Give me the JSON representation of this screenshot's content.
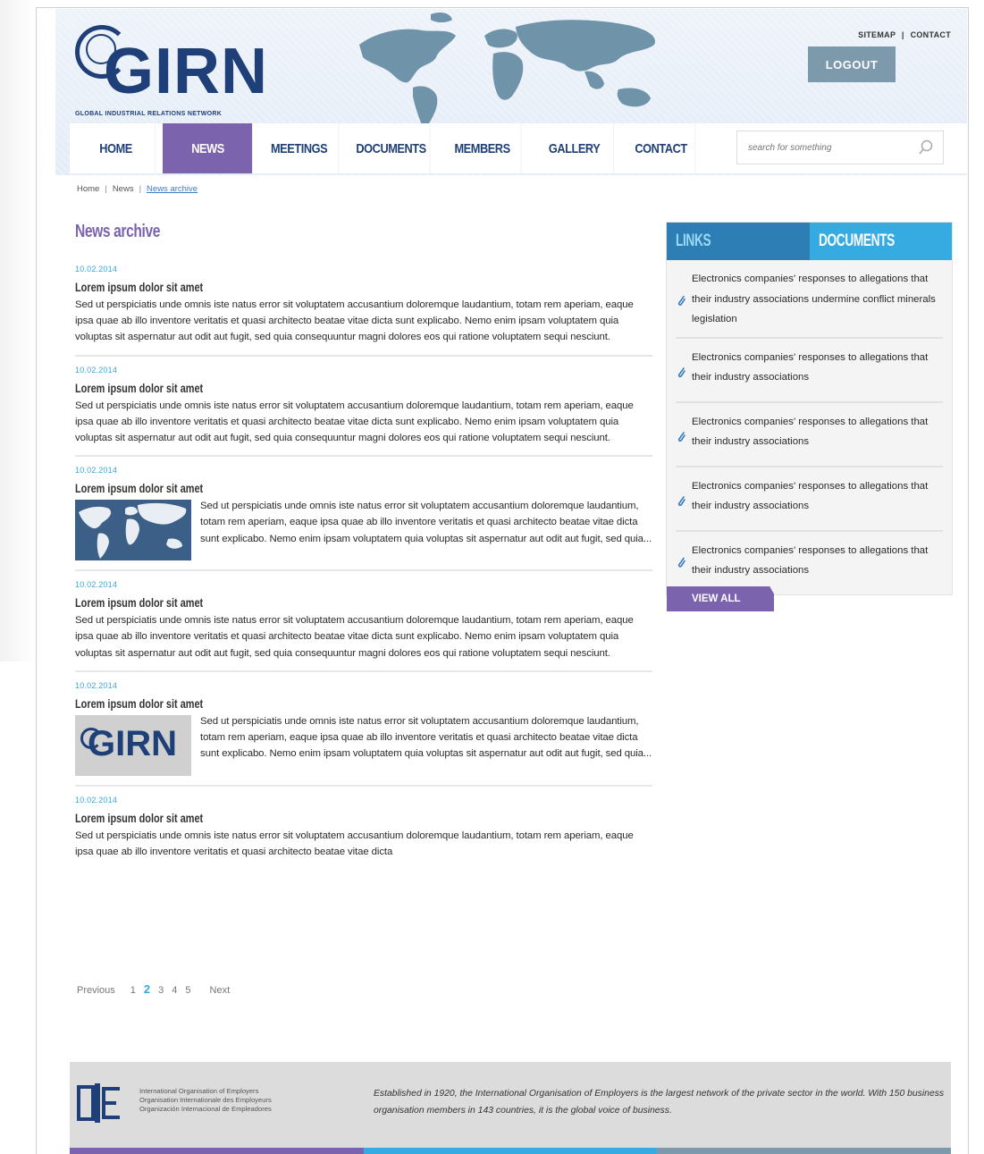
{
  "site": {
    "logo_text": "GIRN",
    "logo_tagline": "GLOBAL INDUSTRIAL RELATIONS NETWORK"
  },
  "toplinks": {
    "sitemap": "SITEMAP",
    "separator": "|",
    "contact": "CONTACT"
  },
  "logout_label": "LOGOUT",
  "nav": [
    {
      "label": "HOME",
      "active": false
    },
    {
      "label": "NEWS",
      "active": true
    },
    {
      "label": "MEETINGS",
      "active": false
    },
    {
      "label": "DOCUMENTS",
      "active": false
    },
    {
      "label": "MEMBERS",
      "active": false
    },
    {
      "label": "GALLERY",
      "active": false
    },
    {
      "label": "CONTACT",
      "active": false
    }
  ],
  "search": {
    "placeholder": "search for something",
    "icon": "search-icon"
  },
  "breadcrumb": {
    "home": "Home",
    "news": "News",
    "current": "News archive"
  },
  "page_title": "News archive",
  "news": [
    {
      "date": "10.02.2014",
      "title": "Lorem ipsum dolor sit amet",
      "image": null,
      "body": "Sed ut perspiciatis unde omnis iste natus error sit voluptatem accusantium doloremque laudantium, totam rem aperiam, eaque ipsa quae ab illo inventore veritatis et quasi architecto beatae vitae dicta sunt explicabo. Nemo enim ipsam voluptatem quia voluptas sit aspernatur aut odit aut fugit, sed quia consequuntur magni dolores eos qui ratione voluptatem sequi nesciunt."
    },
    {
      "date": "10.02.2014",
      "title": "Lorem ipsum dolor sit amet",
      "image": null,
      "body": "Sed ut perspiciatis unde omnis iste natus error sit voluptatem accusantium doloremque laudantium, totam rem aperiam, eaque ipsa quae ab illo inventore veritatis et quasi architecto beatae vitae dicta sunt explicabo. Nemo enim ipsam voluptatem quia voluptas sit aspernatur aut odit aut fugit, sed quia consequuntur magni dolores eos qui ratione voluptatem sequi nesciunt."
    },
    {
      "date": "10.02.2014",
      "title": "Lorem ipsum dolor sit amet",
      "image": "map",
      "body": "Sed ut perspiciatis unde omnis iste natus error sit voluptatem accusantium doloremque laudantium, totam rem aperiam, eaque ipsa quae ab illo inventore veritatis et quasi architecto beatae vitae dicta sunt explicabo. Nemo enim ipsam voluptatem quia voluptas sit aspernatur aut odit aut fugit, sed quia..."
    },
    {
      "date": "10.02.2014",
      "title": "Lorem ipsum dolor sit amet",
      "image": null,
      "body": "Sed ut perspiciatis unde omnis iste natus error sit voluptatem accusantium doloremque laudantium, totam rem aperiam, eaque ipsa quae ab illo inventore veritatis et quasi architecto beatae vitae dicta sunt explicabo. Nemo enim ipsam voluptatem quia voluptas sit aspernatur aut odit aut fugit, sed quia consequuntur magni dolores eos qui ratione voluptatem sequi nesciunt."
    },
    {
      "date": "10.02.2014",
      "title": "Lorem ipsum dolor sit amet",
      "image": "girn-logo",
      "image_text": "GIRN",
      "body": "Sed ut perspiciatis unde omnis iste natus error sit voluptatem accusantium doloremque laudantium, totam rem aperiam, eaque ipsa quae ab illo inventore veritatis et quasi architecto beatae vitae dicta sunt explicabo. Nemo enim ipsam voluptatem quia voluptas sit aspernatur aut odit aut fugit, sed quia..."
    },
    {
      "date": "10.02.2014",
      "title": "Lorem ipsum dolor sit amet",
      "image": null,
      "body": "Sed ut perspiciatis unde omnis iste natus error sit voluptatem accusantium doloremque laudantium, totam rem aperiam, eaque ipsa quae ab illo inventore veritatis et quasi architecto beatae vitae dicta"
    }
  ],
  "pager": {
    "previous": "Previous",
    "pages": [
      "1",
      "2",
      "3",
      "4",
      "5"
    ],
    "current": "2",
    "next": "Next"
  },
  "sidebar": {
    "tab_links": "LINKS",
    "tab_documents": "DOCUMENTS",
    "items": [
      "Electronics companies' responses to allegations that their industry associations undermine conflict minerals legislation",
      "Electronics companies' responses to allegations that their industry associations",
      "Electronics companies' responses to allegations that their industry associations",
      "Electronics companies' responses to allegations that their industry associations",
      "Electronics companies' responses to allegations that their industry associations"
    ],
    "view_all": "VIEW ALL"
  },
  "footer": {
    "org_lines": [
      "International Organisation of Employers",
      "Organisation Internationale des Employeurs",
      "Organización Internacional de Empleadores"
    ],
    "tagline": "Established in 1920, the International Organisation of Employers is the largest network of the private sector in the world. With 150 business organisation members in 143 countries, it is the global voice of business."
  },
  "colors": {
    "brand_navy": "#1e3f78",
    "accent_purple": "#7c63ad",
    "accent_blue": "#36abe2",
    "link_blue": "#2e7eb6",
    "steel": "#7c9aab"
  }
}
